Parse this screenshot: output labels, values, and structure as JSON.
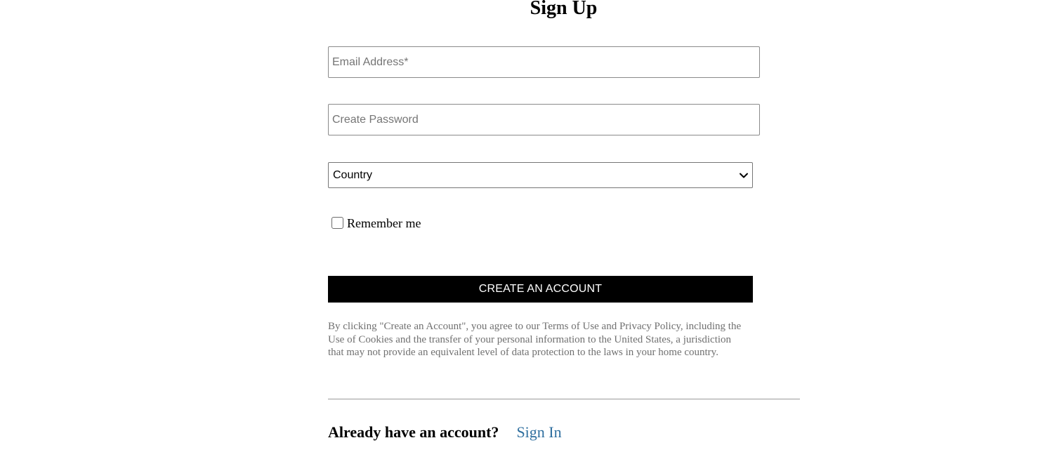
{
  "page": {
    "title": "Sign Up"
  },
  "form": {
    "email": {
      "placeholder": "Email Address*",
      "value": ""
    },
    "password": {
      "placeholder": "Create Password",
      "value": ""
    },
    "country": {
      "selected": "Country"
    },
    "remember": {
      "label": "Remember me",
      "checked": false
    },
    "submit_label": "CREATE AN ACCOUNT",
    "legal_text": "By clicking \"Create an Account\", you agree to our Terms of Use and Privacy Policy, including the Use of Cookies and the transfer of your personal information to the United States, a jurisdiction that may not provide an equivalent level of data protection to the laws in your home country."
  },
  "footer": {
    "prompt": "Already have an account?",
    "signin_label": "Sign In"
  },
  "colors": {
    "button_bg": "#000000",
    "button_text": "#ffffff",
    "link": "#2f6f9f",
    "legal_text": "#707070"
  },
  "icons": {
    "country_select": "chevron-down-icon"
  }
}
